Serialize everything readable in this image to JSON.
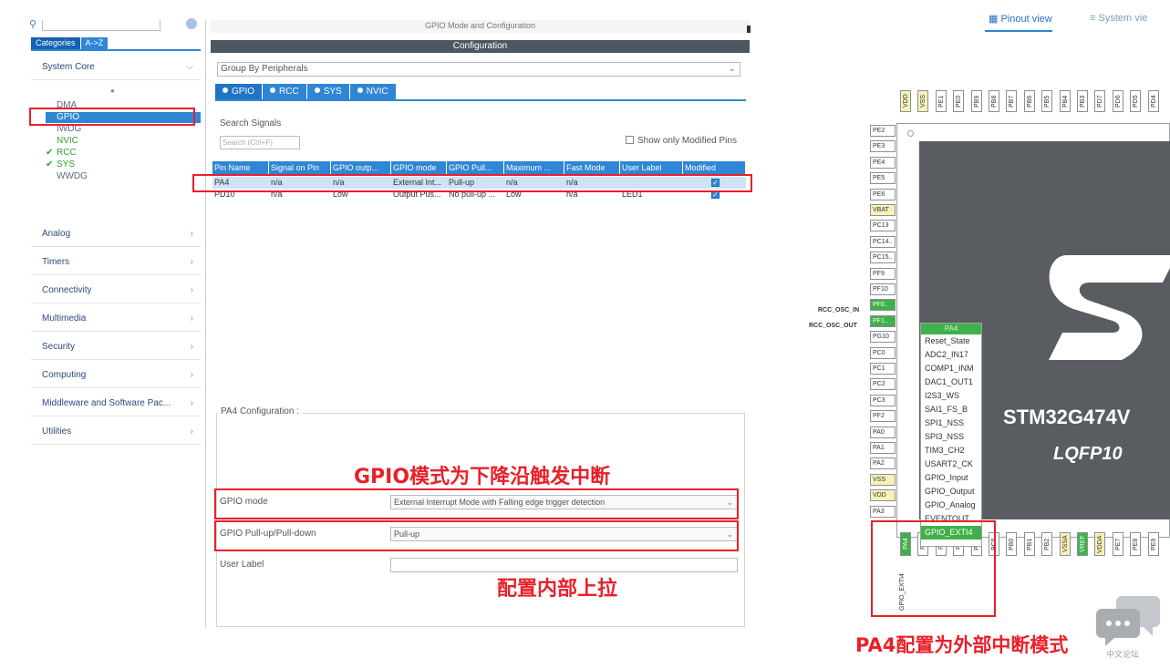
{
  "left": {
    "tabs": [
      "Categories",
      "A->Z"
    ],
    "groups": [
      {
        "label": "System Core"
      },
      {
        "label": "Analog"
      },
      {
        "label": "Timers"
      },
      {
        "label": "Connectivity"
      },
      {
        "label": "Multimedia"
      },
      {
        "label": "Security"
      },
      {
        "label": "Computing"
      },
      {
        "label": "Middleware and Software Pac..."
      },
      {
        "label": "Utilities"
      }
    ],
    "system_core_items": [
      {
        "label": "DMA",
        "state": "normal"
      },
      {
        "label": "GPIO",
        "state": "selected"
      },
      {
        "label": "IWDG",
        "state": "normal"
      },
      {
        "label": "NVIC",
        "state": "green"
      },
      {
        "label": "RCC",
        "state": "check"
      },
      {
        "label": "SYS",
        "state": "check"
      },
      {
        "label": "WWDG",
        "state": "normal"
      }
    ]
  },
  "mid": {
    "title": "GPIO Mode and Configuration",
    "config_bar": "Configuration",
    "group_select": "Group By Peripherals",
    "tabs": [
      "GPIO",
      "RCC",
      "SYS",
      "NVIC"
    ],
    "search_label": "Search Signals",
    "search_placeholder": "Search (Ctrl+F)",
    "show_modified": "Show only Modified Pins",
    "columns": [
      "Pin Name",
      "Signal on Pin",
      "GPIO outp...",
      "GPIO mode",
      "GPIO Pull...",
      "Maximum ...",
      "Fast Mode",
      "User Label",
      "Modified"
    ],
    "rows": [
      [
        "PA4",
        "n/a",
        "n/a",
        "External Int...",
        "Pull-up",
        "n/a",
        "n/a",
        "",
        "✓"
      ],
      [
        "PD10",
        "n/a",
        "Low",
        "Output Pus...",
        "No pull-up ...",
        "Low",
        "n/a",
        "LED1",
        "✓"
      ]
    ],
    "pa4_config": "PA4 Configuration :",
    "cfg_rows": [
      {
        "label": "GPIO mode",
        "value": "External Interrupt Mode with Falling edge trigger detection"
      },
      {
        "label": "GPIO Pull-up/Pull-down",
        "value": "Pull-up"
      },
      {
        "label": "User Label",
        "value": ""
      }
    ]
  },
  "annotations": {
    "gpio_mode": "GPIO模式为下降沿触发中断",
    "pullup": "配置内部上拉",
    "pa4": "PA4配置为外部中断模式"
  },
  "right": {
    "tab1": "Pinout view",
    "tab2": "System vie",
    "chip_name": "STM32G474V",
    "package": "LQFP10",
    "rcc_in": "RCC_OSC_IN",
    "rcc_out": "RCC_OSC_OUT",
    "gpio_exti": "GPIO_EXTI4",
    "top_pins": [
      "VDD",
      "VSS",
      "PE1",
      "PE0",
      "PB9",
      "PB8",
      "PB7",
      "PB6",
      "PB5",
      "PB4",
      "PB3",
      "PD7",
      "PD6",
      "PD5",
      "PD4"
    ],
    "left_pins": [
      "PE2",
      "PE3",
      "PE4",
      "PE5",
      "PE6",
      "VBAT",
      "PC13",
      "PC14..",
      "PC15..",
      "PF9",
      "PF10",
      "PF0..",
      "PF1..",
      "PG10",
      "PC0",
      "PC1",
      "PC2",
      "PC3",
      "PF2",
      "PA0",
      "PA1",
      "PA2",
      "VSS",
      "VDD",
      "PA3"
    ],
    "bottom_pins": [
      "PA4",
      "PA5",
      "PA6",
      "PA7",
      "PC4",
      "PC5",
      "PB0",
      "PB1",
      "PB2",
      "VSSA",
      "VREF",
      "VDDA",
      "PE7",
      "PE8",
      "PE9"
    ],
    "menu_header": "PA4",
    "menu_items": [
      "Reset_State",
      "ADC2_IN17",
      "COMP1_INM",
      "DAC1_OUT1",
      "I2S3_WS",
      "SAI1_FS_B",
      "SPI1_NSS",
      "SPI3_NSS",
      "TIM3_CH2",
      "USART2_CK",
      "GPIO_Input",
      "GPIO_Output",
      "GPIO_Analog",
      "EVENTOUT",
      "GPIO_EXTI4"
    ],
    "watermark": "中文论坛"
  },
  "colors": {
    "accent": "#2f86d4",
    "highlight": "#e8202a",
    "pin_green": "#40b04a"
  }
}
